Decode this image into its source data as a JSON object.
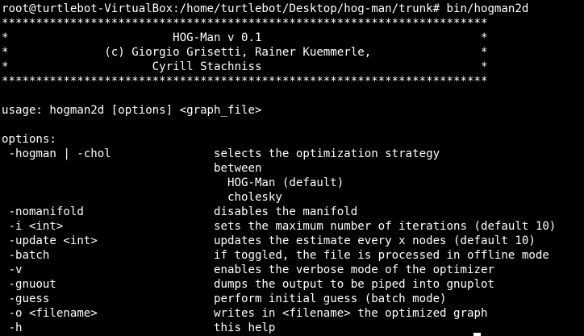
{
  "terminal": {
    "lines": [
      "root@turtlebot-VirtualBox:/home/turtlebot/Desktop/hog-man/trunk# bin/hogman2d",
      "***********************************************************************",
      "*                        HOG-Man v 0.1                                *",
      "*              (c) Giorgio Grisetti, Rainer Kuemmerle,                *",
      "*                     Cyrill Stachniss                                *",
      "***********************************************************************",
      "",
      "usage: hogman2d [options] <graph_file>",
      "",
      "options:",
      " -hogman | -chol               selects the optimization strategy",
      "                               between",
      "                                 HOG-Man (default)",
      "                                 cholesky",
      " -nomanifold                   disables the manifold",
      " -i <int>                      sets the maximum number of iterations (default 10)",
      " -update <int>                 updates the estimate every x nodes (default 10)",
      " -batch                        if toggled, the file is processed in offline mode",
      " -v                            enables the verbose mode of the optimizer",
      " -gnuout                       dumps the output to be piped into gnuplot",
      " -guess                        perform initial guess (batch mode)",
      " -o <filename>                 writes in <filename> the optimized graph",
      " -h                            this help"
    ]
  }
}
